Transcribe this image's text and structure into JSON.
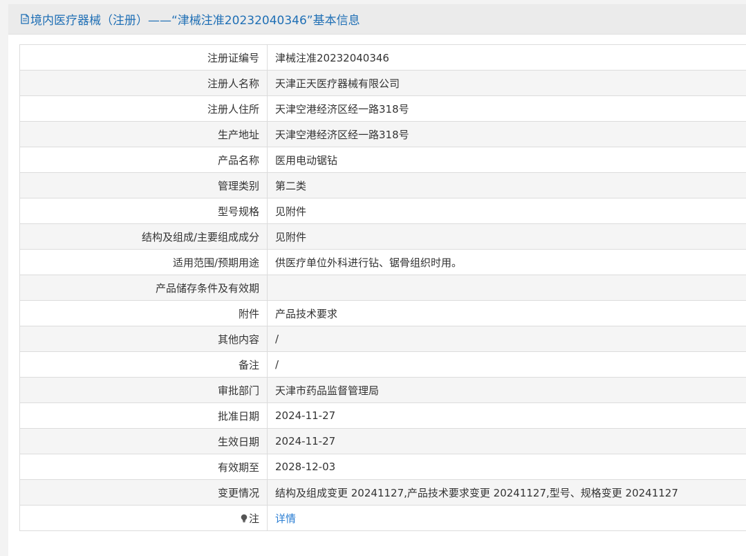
{
  "header": {
    "title": "境内医疗器械（注册）——“津械注准20232040346”基本信息"
  },
  "rows": [
    {
      "label": "注册证编号",
      "value": "津械注准20232040346"
    },
    {
      "label": "注册人名称",
      "value": "天津正天医疗器械有限公司"
    },
    {
      "label": "注册人住所",
      "value": "天津空港经济区经一路318号"
    },
    {
      "label": "生产地址",
      "value": "天津空港经济区经一路318号"
    },
    {
      "label": "产品名称",
      "value": "医用电动锯钻"
    },
    {
      "label": "管理类别",
      "value": "第二类"
    },
    {
      "label": "型号规格",
      "value": "见附件"
    },
    {
      "label": "结构及组成/主要组成成分",
      "value": "见附件"
    },
    {
      "label": "适用范围/预期用途",
      "value": "供医疗单位外科进行钻、锯骨组织时用。"
    },
    {
      "label": "产品储存条件及有效期",
      "value": ""
    },
    {
      "label": "附件",
      "value": "产品技术要求"
    },
    {
      "label": "其他内容",
      "value": "/"
    },
    {
      "label": "备注",
      "value": "/"
    },
    {
      "label": "审批部门",
      "value": "天津市药品监督管理局"
    },
    {
      "label": "批准日期",
      "value": "2024-11-27"
    },
    {
      "label": "生效日期",
      "value": "2024-11-27"
    },
    {
      "label": "有效期至",
      "value": "2028-12-03"
    },
    {
      "label": "变更情况",
      "value": "结构及组成变更 20241127,产品技术要求变更 20241127,型号、规格变更 20241127"
    }
  ],
  "note_row": {
    "icon": "lightbulb-icon",
    "label": "注",
    "link_text": "详情"
  },
  "colors": {
    "header_text": "#1f6fb5",
    "link": "#2a7ed3",
    "row_stripe": "#f5f5f5",
    "border": "#dcdcdc"
  }
}
